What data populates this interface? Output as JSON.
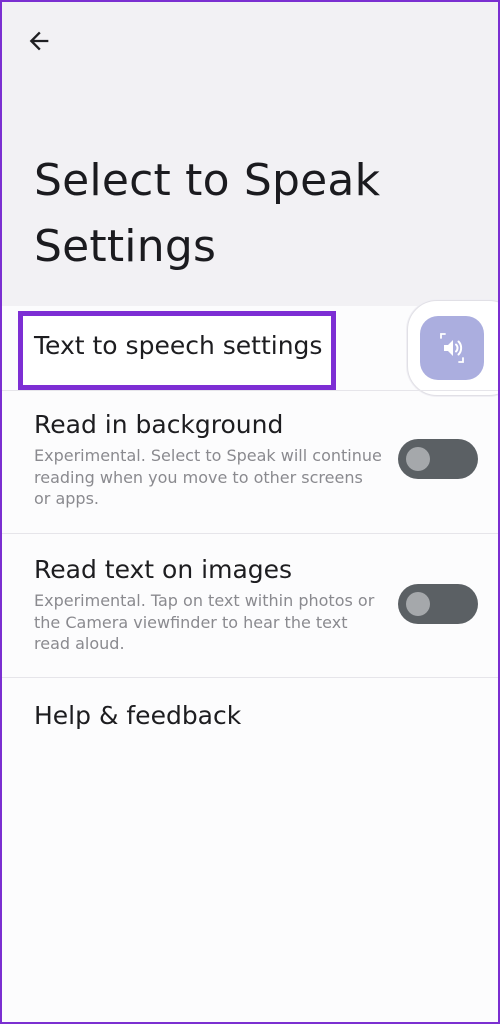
{
  "header": {
    "back_icon": "arrow-left-icon",
    "title": "Select to Speak Settings"
  },
  "settings": {
    "tts": {
      "title": "Text to speech settings",
      "floating_icon": "volume-up-icon",
      "accent_color": "#7d2ed4",
      "button_color": "#abaedf"
    },
    "read_background": {
      "title": "Read in background",
      "summary": "Experimental. Select to Speak will continue reading when you move to other screens or apps.",
      "enabled": false
    },
    "read_images": {
      "title": "Read text on images",
      "summary": "Experimental. Tap on text within photos or the Camera viewfinder to hear the text read aloud.",
      "enabled": false
    },
    "help": {
      "title": "Help & feedback"
    }
  },
  "colors": {
    "header_bg": "#f2f1f4",
    "page_bg": "#fcfcfd",
    "toggle_track_off": "#5b6064",
    "toggle_knob_off": "#a5a8ab"
  }
}
